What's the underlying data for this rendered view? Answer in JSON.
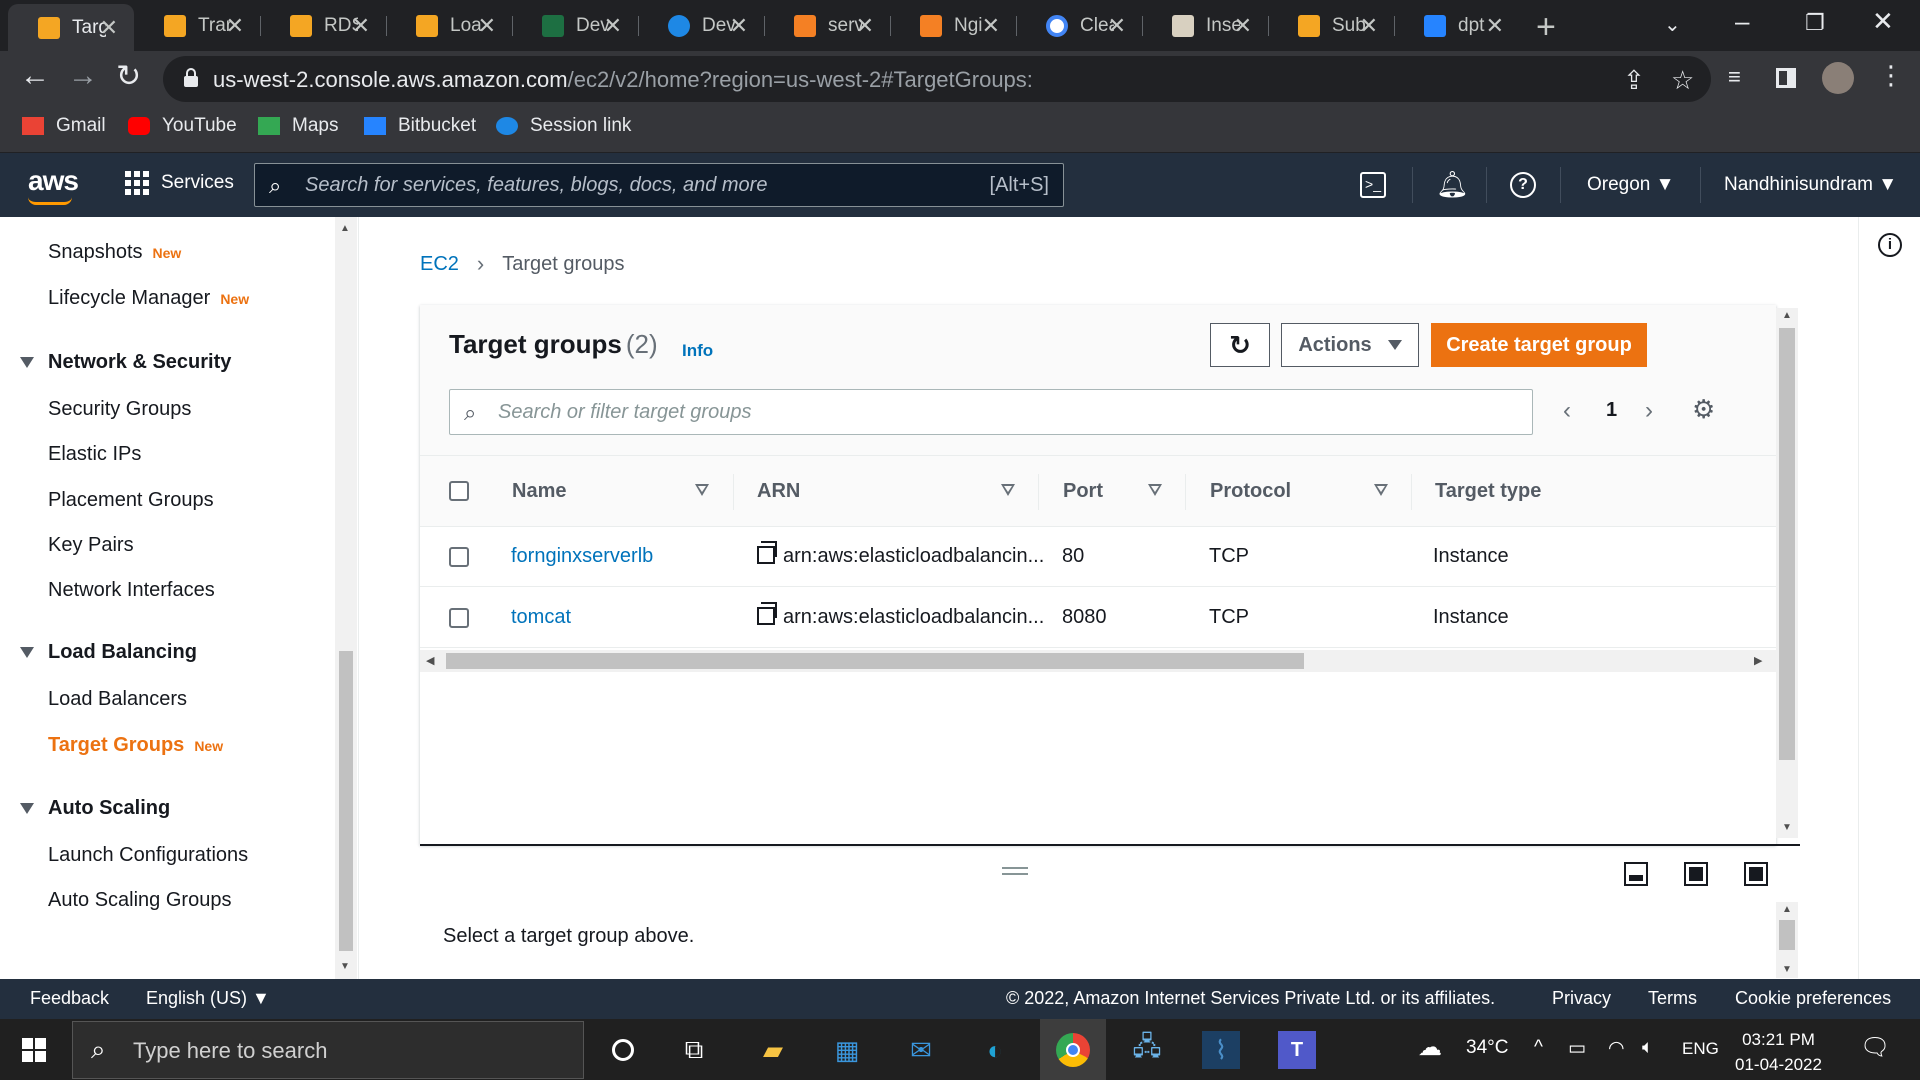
{
  "browser": {
    "tabs": [
      {
        "title": "Targ",
        "icon": "aws-box-icon",
        "active": true
      },
      {
        "title": "Trar",
        "icon": "aws-box-icon"
      },
      {
        "title": "RDS",
        "icon": "aws-box-icon"
      },
      {
        "title": "Loa",
        "icon": "aws-box-icon"
      },
      {
        "title": "Dev",
        "icon": "excel-icon"
      },
      {
        "title": "Dev",
        "icon": "onedrive-icon"
      },
      {
        "title": "serv",
        "icon": "stackoverflow-icon"
      },
      {
        "title": "Ngi",
        "icon": "stackoverflow-icon"
      },
      {
        "title": "Clea",
        "icon": "google-icon"
      },
      {
        "title": "Inse",
        "icon": "image-icon"
      },
      {
        "title": "Sub",
        "icon": "aws-box-icon"
      },
      {
        "title": "dpt",
        "icon": "bitbucket-icon"
      }
    ],
    "url_host": "us-west-2.console.aws.amazon.com",
    "url_path": "/ec2/v2/home?region=us-west-2#TargetGroups:",
    "bookmarks": [
      "Gmail",
      "YouTube",
      "Maps",
      "Bitbucket",
      "Session link"
    ]
  },
  "awsnav": {
    "logo": "aws",
    "services_label": "Services",
    "search_placeholder": "Search for services, features, blogs, docs, and more",
    "search_shortcut": "[Alt+S]",
    "region": "Oregon",
    "user": "Nandhinisundram"
  },
  "sidebar": {
    "items": [
      {
        "type": "item",
        "label": "Snapshots",
        "badge": "New"
      },
      {
        "type": "item",
        "label": "Lifecycle Manager",
        "badge": "New"
      },
      {
        "type": "section",
        "label": "Network & Security"
      },
      {
        "type": "item",
        "label": "Security Groups"
      },
      {
        "type": "item",
        "label": "Elastic IPs"
      },
      {
        "type": "item",
        "label": "Placement Groups"
      },
      {
        "type": "item",
        "label": "Key Pairs"
      },
      {
        "type": "item",
        "label": "Network Interfaces"
      },
      {
        "type": "section",
        "label": "Load Balancing"
      },
      {
        "type": "item",
        "label": "Load Balancers"
      },
      {
        "type": "item",
        "label": "Target Groups",
        "badge": "New",
        "active": true
      },
      {
        "type": "section",
        "label": "Auto Scaling"
      },
      {
        "type": "item",
        "label": "Launch Configurations"
      },
      {
        "type": "item",
        "label": "Auto Scaling Groups"
      }
    ]
  },
  "breadcrumb": {
    "root": "EC2",
    "current": "Target groups"
  },
  "panel": {
    "title": "Target groups",
    "count": "(2)",
    "info": "Info",
    "actions_label": "Actions",
    "create_label": "Create target group",
    "filter_placeholder": "Search or filter target groups",
    "page": "1"
  },
  "table": {
    "columns": [
      "Name",
      "ARN",
      "Port",
      "Protocol",
      "Target type"
    ],
    "rows": [
      {
        "name": "fornginxserverlb",
        "arn": "arn:aws:elasticloadbalancin...",
        "port": "80",
        "protocol": "TCP",
        "target_type": "Instance"
      },
      {
        "name": "tomcat",
        "arn": "arn:aws:elasticloadbalancin...",
        "port": "8080",
        "protocol": "TCP",
        "target_type": "Instance"
      }
    ]
  },
  "details": {
    "empty_message": "Select a target group above."
  },
  "footer": {
    "feedback": "Feedback",
    "language": "English (US)",
    "copyright": "© 2022, Amazon Internet Services Private Ltd. or its affiliates.",
    "privacy": "Privacy",
    "terms": "Terms",
    "cookies": "Cookie preferences"
  },
  "taskbar": {
    "search_placeholder": "Type here to search",
    "temperature": "34°C",
    "language": "ENG",
    "time": "03:21 PM",
    "date": "01-04-2022"
  },
  "colors": {
    "aws_orange": "#ec7211",
    "aws_link": "#0073bb",
    "aws_nav": "#232f3e"
  }
}
